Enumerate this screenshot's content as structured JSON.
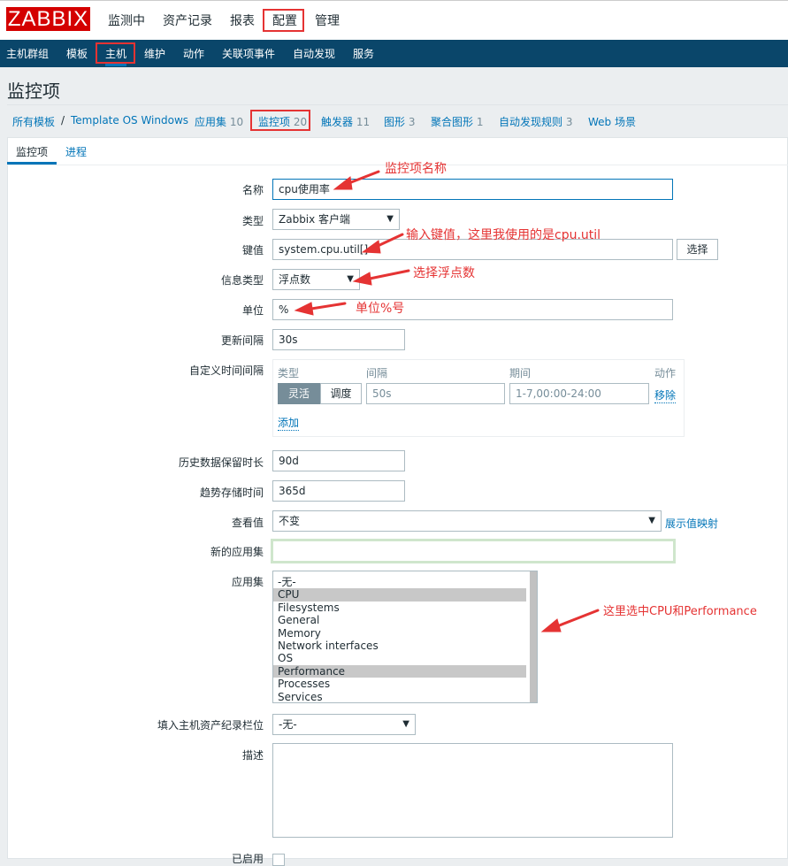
{
  "header": {
    "logo": "ZABBIX",
    "menu": [
      "监测中",
      "资产记录",
      "报表",
      "配置",
      "管理"
    ]
  },
  "subnav": [
    "主机群组",
    "模板",
    "主机",
    "维护",
    "动作",
    "关联项事件",
    "自动发现",
    "服务"
  ],
  "page_title": "监控项",
  "breadcrumb": {
    "root": "所有模板",
    "sep": "/",
    "template": "Template OS Windows",
    "links": [
      {
        "label": "应用集",
        "count": "10"
      },
      {
        "label": "监控项",
        "count": "20"
      },
      {
        "label": "触发器",
        "count": "11"
      },
      {
        "label": "图形",
        "count": "3"
      },
      {
        "label": "聚合图形",
        "count": "1"
      },
      {
        "label": "自动发现规则",
        "count": "3"
      },
      {
        "label": "Web 场景",
        "count": ""
      }
    ]
  },
  "tabs": [
    "监控项",
    "进程"
  ],
  "form": {
    "name": {
      "label": "名称",
      "value": "cpu使用率"
    },
    "type": {
      "label": "类型",
      "value": "Zabbix 客户端"
    },
    "key": {
      "label": "键值",
      "value": "system.cpu.util[]",
      "button": "选择"
    },
    "info_type": {
      "label": "信息类型",
      "value": "浮点数"
    },
    "units": {
      "label": "单位",
      "value": "%"
    },
    "interval": {
      "label": "更新间隔",
      "value": "30s"
    },
    "custom": {
      "label": "自定义时间间隔",
      "col_type": "类型",
      "col_interval": "间隔",
      "col_period": "期间",
      "col_action": "动作",
      "flex": "灵活",
      "sched": "调度",
      "interval_placeholder": "50s",
      "period_placeholder": "1-7,00:00-24:00",
      "remove": "移除",
      "add": "添加"
    },
    "history": {
      "label": "历史数据保留时长",
      "value": "90d"
    },
    "trends": {
      "label": "趋势存储时间",
      "value": "365d"
    },
    "show_value": {
      "label": "查看值",
      "value": "不变",
      "link": "展示值映射"
    },
    "new_app": {
      "label": "新的应用集",
      "value": ""
    },
    "apps": {
      "label": "应用集",
      "items": [
        {
          "t": "-无-",
          "s": false
        },
        {
          "t": "CPU",
          "s": true
        },
        {
          "t": "Filesystems",
          "s": false
        },
        {
          "t": "General",
          "s": false
        },
        {
          "t": "Memory",
          "s": false
        },
        {
          "t": "Network interfaces",
          "s": false
        },
        {
          "t": "OS",
          "s": false
        },
        {
          "t": "Performance",
          "s": true
        },
        {
          "t": "Processes",
          "s": false
        },
        {
          "t": "Services",
          "s": false
        }
      ]
    },
    "inventory": {
      "label": "填入主机资产纪录栏位",
      "value": "-无-"
    },
    "description": {
      "label": "描述",
      "value": ""
    },
    "enabled": {
      "label": "已启用"
    }
  },
  "annotations": {
    "name": "监控项名称",
    "key": "输入键值，这里我使用的是cpu.util",
    "info_type": "选择浮点数",
    "units": "单位%号",
    "apps": "这里选中CPU和Performance"
  },
  "colors": {
    "annotation": "#e53333",
    "nav": "#0a466a",
    "logo": "#d40000",
    "link": "#0275b8"
  }
}
